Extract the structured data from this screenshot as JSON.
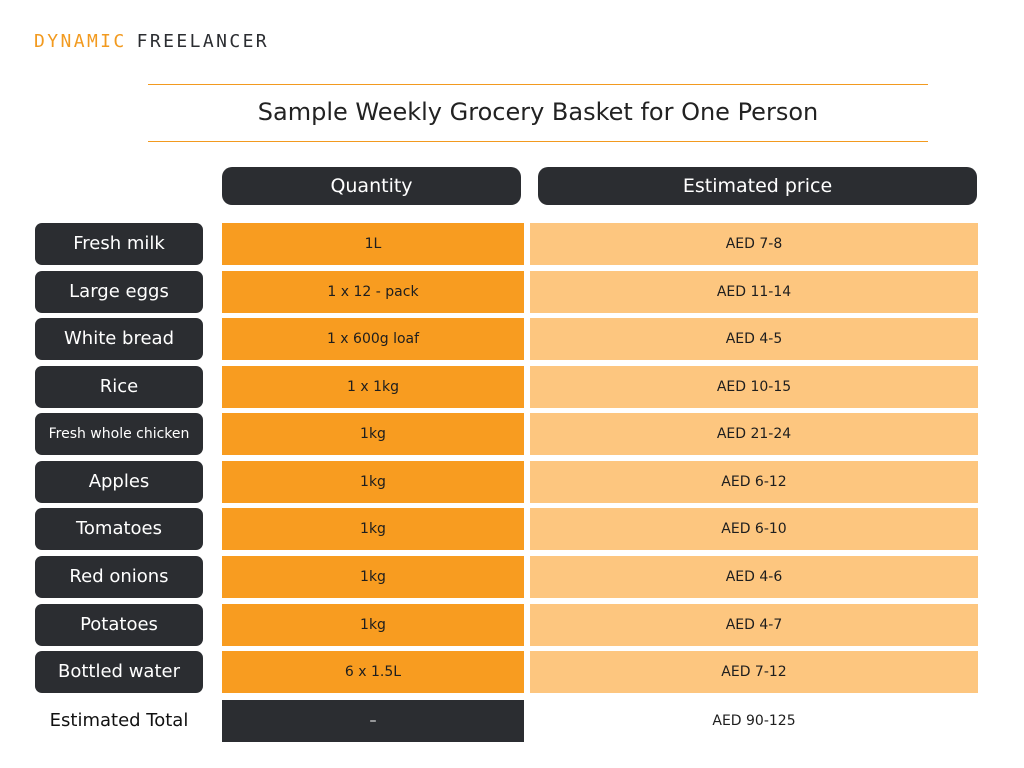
{
  "brand": {
    "part1": "DYNAMIC",
    "part2": "FREELANCER"
  },
  "title": "Sample Weekly Grocery Basket for One Person",
  "columns": {
    "quantity": "Quantity",
    "price": "Estimated price"
  },
  "rows": [
    {
      "item": "Fresh milk",
      "quantity": "1L",
      "price": "AED 7-8"
    },
    {
      "item": "Large eggs",
      "quantity": "1 x 12 - pack",
      "price": "AED 11-14"
    },
    {
      "item": "White bread",
      "quantity": "1 x 600g loaf",
      "price": "AED 4-5"
    },
    {
      "item": "Rice",
      "quantity": "1 x 1kg",
      "price": "AED 10-15"
    },
    {
      "item": "Fresh whole chicken",
      "quantity": "1kg",
      "price": "AED 21-24"
    },
    {
      "item": "Apples",
      "quantity": "1kg",
      "price": "AED 6-12"
    },
    {
      "item": "Tomatoes",
      "quantity": "1kg",
      "price": "AED 6-10"
    },
    {
      "item": "Red onions",
      "quantity": "1kg",
      "price": "AED 4-6"
    },
    {
      "item": "Potatoes",
      "quantity": "1kg",
      "price": "AED 4-7"
    },
    {
      "item": "Bottled water",
      "quantity": "6 x 1.5L",
      "price": "AED 7-12"
    }
  ],
  "total": {
    "label": "Estimated Total",
    "quantity": "–",
    "price": "AED 90-125"
  },
  "colors": {
    "accent": "#f29a1f",
    "dark": "#2b2d31",
    "quantity_fill": "#f89c20",
    "price_fill": "#fdc67f"
  }
}
